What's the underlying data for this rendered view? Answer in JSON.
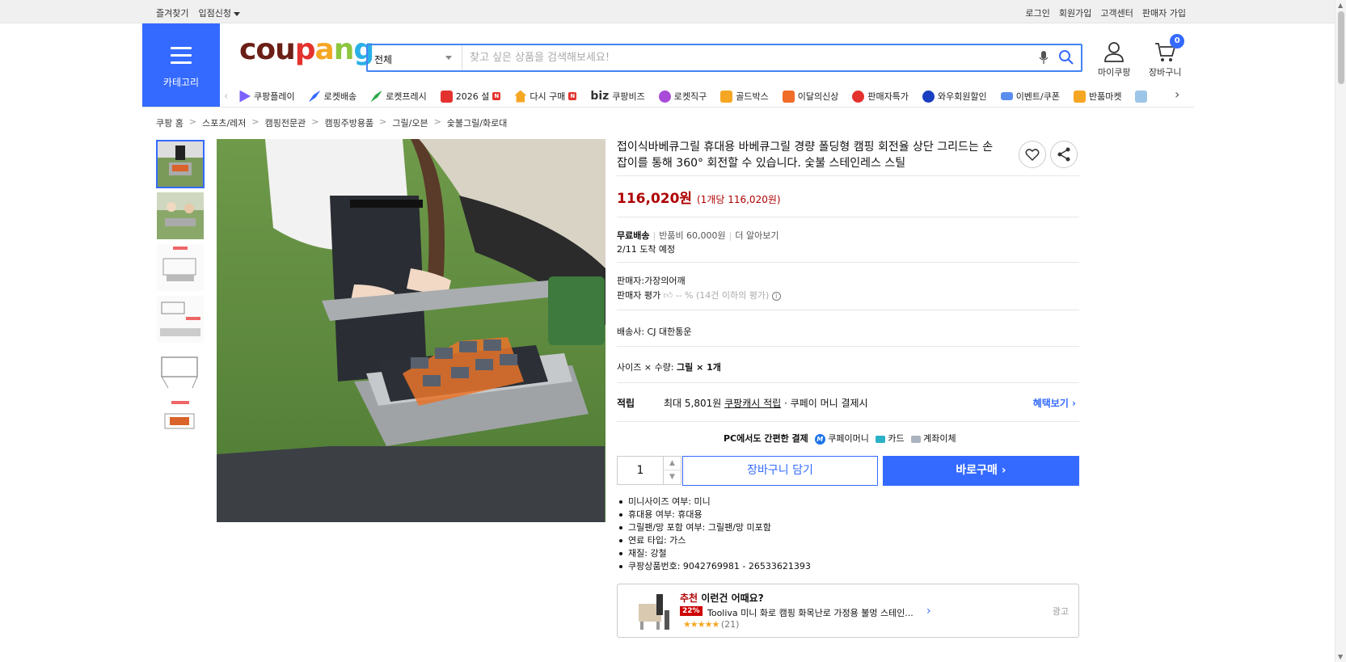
{
  "topbar": {
    "left": [
      "즐겨찾기",
      "입점신청"
    ],
    "right": [
      "로그인",
      "회원가입",
      "고객센터",
      "판매자 가입"
    ]
  },
  "category": {
    "label": "카테고리"
  },
  "logo": {
    "text": [
      "cou",
      "p",
      "a",
      "n",
      "g"
    ]
  },
  "search": {
    "scope": "전체",
    "placeholder": "찾고 싶은 상품을 검색해보세요!"
  },
  "header_icons": {
    "mypage": "마이쿠팡",
    "cart": "장바구니",
    "cart_count": "0"
  },
  "gnb": [
    {
      "label": "쿠팡플레이",
      "icon_color": "#7b61ff"
    },
    {
      "label": "로켓배송",
      "icon_color": "#346aff"
    },
    {
      "label": "로켓프레시",
      "icon_color": "#2ea84a"
    },
    {
      "label": "2026 설",
      "icon_color": "#e3322e",
      "new": "N"
    },
    {
      "label": "다시 구매",
      "icon_color": "#f5a623",
      "new": "N"
    },
    {
      "label": "쿠팡비즈",
      "prefix": "biz"
    },
    {
      "label": "로켓직구",
      "icon_color": "#a74bd8"
    },
    {
      "label": "골드박스",
      "icon_color": "#f5a623"
    },
    {
      "label": "이달의신상",
      "icon_color": "#f06d2a"
    },
    {
      "label": "판매자특가",
      "icon_color": "#e3322e"
    },
    {
      "label": "와우회원할인",
      "icon_color": "#1a3fbf"
    },
    {
      "label": "이벤트/쿠폰",
      "icon_color": "#5b8def"
    },
    {
      "label": "반품마켓",
      "icon_color": "#f5a623"
    }
  ],
  "breadcrumb": [
    "쿠팡 홈",
    "스포츠/레저",
    "캠핑전문관",
    "캠핑주방용품",
    "그릴/오븐",
    "숯불그릴/화로대"
  ],
  "product": {
    "title": "접이식바베큐그릴 휴대용 바베큐그릴 경량 폴딩형 캠핑 회전율 상단 그리드는 손잡이를 통해 360° 회전할 수 있습니다. 숯불 스테인레스 스틸",
    "price": "116,020원",
    "unit_price": "(1개당 116,020원)",
    "shipping": {
      "free": "무료배송",
      "return_fee": "반품비 60,000원",
      "more": "더 알아보기",
      "arrival": "2/11 도착 예정"
    },
    "seller": "판매자:가장의어깨",
    "seller_rating_label": "판매자 평가",
    "seller_rating_value": "-- % (14건 이하의 평가)",
    "carrier": "배송사:  CJ 대한통운",
    "option_prefix": "사이즈 × 수량:",
    "option_value": "그릴 × 1개",
    "reward": {
      "label": "적립",
      "text_prefix": "최대 5,801원",
      "link": "쿠팡캐시 적립",
      "suffix": "· 쿠페이 머니 결제시",
      "more": "혜택보기"
    },
    "pay": {
      "label": "PC에서도 간편한 결제",
      "methods": [
        "쿠페이머니",
        "카드",
        "계좌이체"
      ]
    },
    "quantity": "1",
    "cart_button": "장바구니 담기",
    "buy_button": "바로구매",
    "attributes": [
      "미니사이즈 여부: 미니",
      "휴대용 여부: 휴대용",
      "그릴팬/망 포함 여부: 그릴팬/망 미포함",
      "연료 타입: 가스",
      "재질: 강철",
      "쿠팡상품번호: 9042769981 - 26533621393"
    ]
  },
  "ad": {
    "rec_prefix": "추천",
    "rec_text": "이런건 어때요?",
    "discount": "22%",
    "name": "Tooliva 미니 화로 캠핑 화목난로 가정용 불멍 스테인...",
    "rating_count": "(21)",
    "ad_label": "광고"
  }
}
